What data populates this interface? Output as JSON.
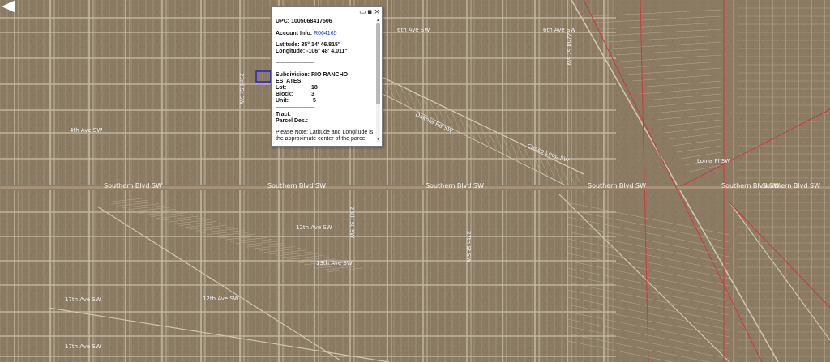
{
  "map": {
    "street_labels": [
      {
        "text": "Southern Blvd SW",
        "orient": "h"
      },
      {
        "text": "Southern Blvd SW",
        "orient": "h"
      },
      {
        "text": "Southern Blvd SW",
        "orient": "h"
      },
      {
        "text": "Southern Blvd SW",
        "orient": "h"
      },
      {
        "text": "Southern Blvd SW",
        "orient": "h"
      },
      {
        "text": "6th Ave SW",
        "orient": "h"
      },
      {
        "text": "6th Ave SW",
        "orient": "h"
      },
      {
        "text": "4th Ave SW",
        "orient": "h"
      },
      {
        "text": "12th Ave SW",
        "orient": "h"
      },
      {
        "text": "13th Ave SW",
        "orient": "h"
      },
      {
        "text": "17th Ave SW",
        "orient": "h"
      },
      {
        "text": "17th Ave SW",
        "orient": "h"
      },
      {
        "text": "12th Ave SW",
        "orient": "h"
      },
      {
        "text": "Dakota Rd SW",
        "orient": "h"
      },
      {
        "text": "Chaco Loop SW",
        "orient": "h"
      },
      {
        "text": "23rd St SW",
        "orient": "v"
      },
      {
        "text": "25th St SW",
        "orient": "v"
      },
      {
        "text": "27th St SW",
        "orient": "v"
      },
      {
        "text": "22nd St SW",
        "orient": "v"
      },
      {
        "text": "Loma Pl SW",
        "orient": "h"
      },
      {
        "text": "Southern Blvd SW",
        "orient": "h"
      }
    ],
    "parcel_color": "#2222dd",
    "road_line_color": "#cc3333"
  },
  "popup": {
    "upc_label": "UPC:",
    "upc_value": "1005068417506",
    "account_label": "Account Info:",
    "account_value": "R064165",
    "latitude_label": "Latitude:",
    "latitude_value": "35° 14' 46.815\"",
    "longitude_label": "Longitude:",
    "longitude_value": "-106° 48' 4.011\"",
    "divider": "--------------------------------",
    "subdivision_label": "Subdivision:",
    "subdivision_value": "RIO RANCHO ESTATES",
    "lot_label": "Lot:",
    "lot_value": "18",
    "block_label": "Block:",
    "block_value": "3",
    "unit_label": "Unit:",
    "unit_value": "5",
    "divider2": "--------------------------------",
    "tract_label": "Tract:",
    "parcel_des_label": "Parcel Des.:",
    "note": "Please Note: Latitude and Longitude is the approximate center of the parcel shown.",
    "minimize_icon": "minimize-icon",
    "maximize_icon": "maximize-icon",
    "close_icon": "close-icon"
  }
}
